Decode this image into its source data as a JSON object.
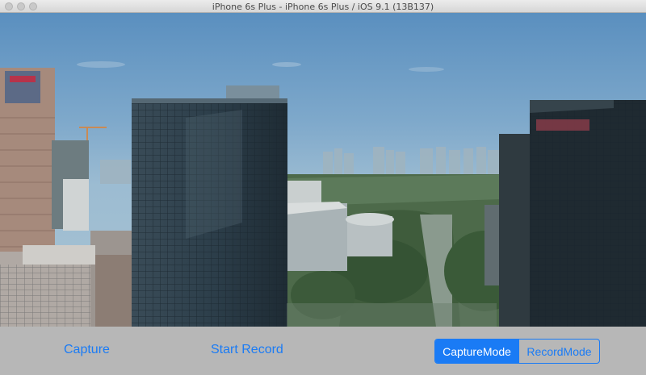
{
  "window": {
    "title": "iPhone 6s Plus - iPhone 6s Plus / iOS 9.1 (13B137)"
  },
  "preview": {
    "content": "aerial city skyline camera preview"
  },
  "toolbar": {
    "capture_label": "Capture",
    "start_record_label": "Start Record",
    "mode": {
      "options": [
        "CaptureMode",
        "RecordMode"
      ],
      "selected": "CaptureMode"
    }
  },
  "colors": {
    "accent": "#1a7bf5",
    "toolbar_bg": "#b7b7b7"
  }
}
